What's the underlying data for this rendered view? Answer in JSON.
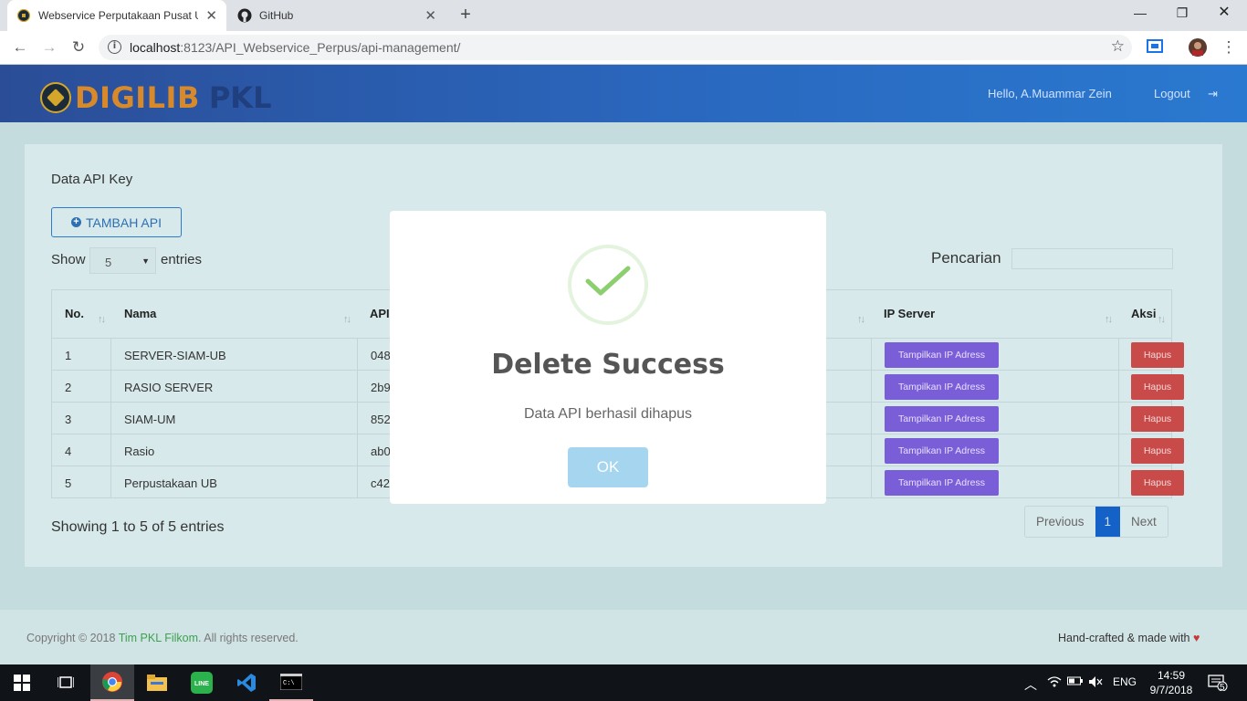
{
  "browser": {
    "tabs": [
      {
        "title": "Webservice Perputakaan Pusat U",
        "active": true
      },
      {
        "title": "GitHub",
        "active": false
      }
    ],
    "url_host": "localhost",
    "url_rest": ":8123/API_Webservice_Perpus/api-management/"
  },
  "header": {
    "logo_part1": "DIGILIB",
    "logo_part2": "PKL",
    "greeting": "Hello, A.Muammar Zein",
    "logout": "Logout"
  },
  "card": {
    "title": "Data API Key",
    "add_button": "TAMBAH API",
    "show_label": "Show",
    "entries_value": "5",
    "entries_label": "entries",
    "search_label": "Pencarian"
  },
  "table": {
    "headers": [
      "No.",
      "Nama",
      "API Key",
      "",
      "IP Server",
      "Aksi"
    ],
    "rows": [
      {
        "no": "1",
        "nama": "SERVER-SIAM-UB",
        "key": "0481f06"
      },
      {
        "no": "2",
        "nama": "RASIO SERVER",
        "key": "2b93d3"
      },
      {
        "no": "3",
        "nama": "SIAM-UM",
        "key": "8527e5"
      },
      {
        "no": "4",
        "nama": "Rasio",
        "key": "ab02fb7"
      },
      {
        "no": "5",
        "nama": "Perpustakaan UB",
        "key": "c4204b"
      }
    ],
    "ip_button": "Tampilkan IP Adress",
    "delete_button": "Hapus"
  },
  "pagination": {
    "summary": "Showing 1 to 5 of 5 entries",
    "previous": "Previous",
    "current": "1",
    "next": "Next"
  },
  "footer": {
    "copyright_prefix": "Copyright © 2018 ",
    "team": "Tim PKL Filkom",
    "copyright_suffix": ". All rights reserved.",
    "handmade": "Hand-crafted & made with"
  },
  "modal": {
    "title": "Delete Success",
    "message": "Data API berhasil dihapus",
    "ok": "OK"
  },
  "taskbar": {
    "language": "ENG",
    "time": "14:59",
    "date": "9/7/2018",
    "notifications": "5"
  },
  "colors": {
    "accent": "#1461c7",
    "success": "#8ccf6f",
    "danger": "#c84b4a",
    "ip_button": "#7a5ed8"
  }
}
